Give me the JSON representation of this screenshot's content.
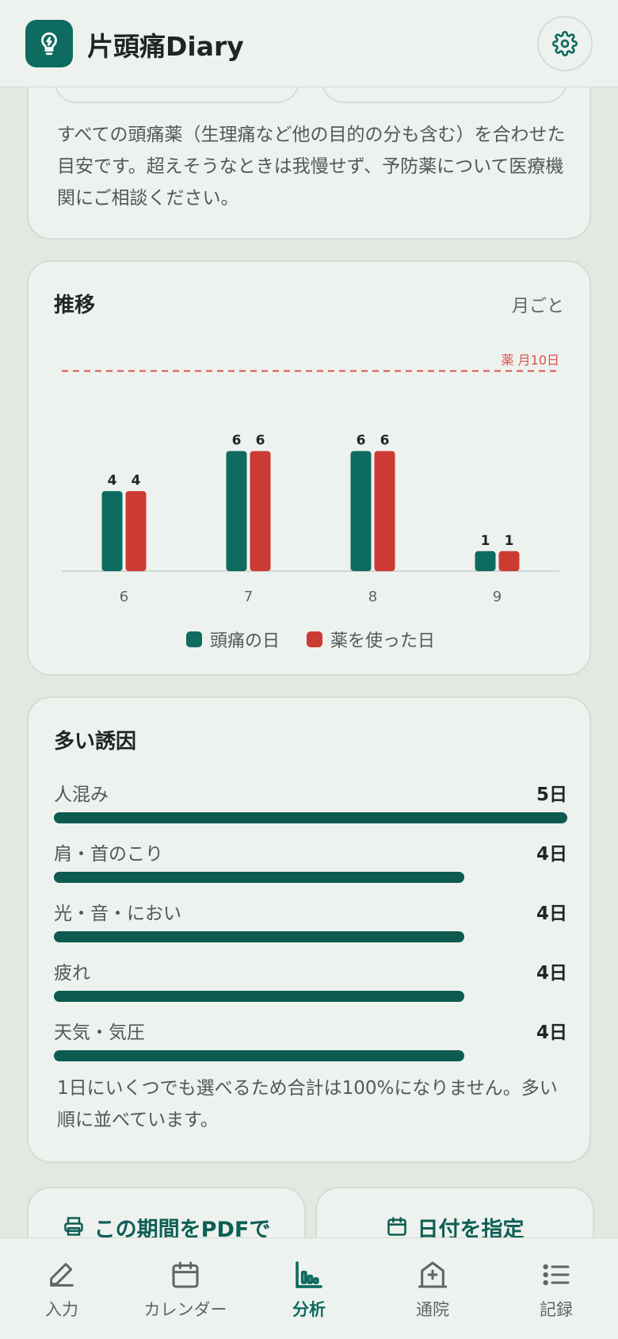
{
  "header": {
    "app_title": "片頭痛Diary",
    "logo_icon": "lightbulb-icon",
    "settings_icon": "gear-icon"
  },
  "medicine_card": {
    "note": "すべての頭痛薬（生理痛など他の目的の分も含む）を合わせた目安です。超えそうなときは我慢せず、予防薬について医療機関にご相談ください。"
  },
  "trend_card": {
    "title": "推移",
    "period": "月ごと"
  },
  "chart_data": {
    "type": "bar",
    "title": "推移",
    "categories": [
      "6",
      "7",
      "8",
      "9"
    ],
    "series": [
      {
        "name": "頭痛の日",
        "values": [
          4,
          6,
          6,
          1
        ],
        "color": "#0e6b60"
      },
      {
        "name": "薬を使った日",
        "values": [
          4,
          6,
          6,
          1
        ],
        "color": "#cc3b33"
      }
    ],
    "reference_line": {
      "value": 10,
      "label": "薬 月10日",
      "color": "#d9534f"
    },
    "ylim": [
      0,
      10.7
    ],
    "xlabel": "",
    "ylabel": "",
    "grid": false,
    "legend": "bottom"
  },
  "triggers_card": {
    "title": "多い誘因",
    "items": [
      {
        "name": "人混み",
        "count": "5日",
        "value": 5
      },
      {
        "name": "肩・首のこり",
        "count": "4日",
        "value": 4
      },
      {
        "name": "光・音・におい",
        "count": "4日",
        "value": 4
      },
      {
        "name": "疲れ",
        "count": "4日",
        "value": 4
      },
      {
        "name": "天気・気圧",
        "count": "4日",
        "value": 4
      }
    ],
    "max_value": 5,
    "note": "1日にいくつでも選べるため合計は100%になりません。多い順に並べています。"
  },
  "actions": {
    "pdf_label": "この期間をPDFで",
    "pdf_icon": "printer-icon",
    "date_label": "日付を指定",
    "date_icon": "calendar-icon"
  },
  "nav": {
    "items": [
      {
        "label": "入力",
        "icon": "pencil-icon"
      },
      {
        "label": "カレンダー",
        "icon": "calendar-icon"
      },
      {
        "label": "分析",
        "icon": "bar-chart-icon"
      },
      {
        "label": "通院",
        "icon": "hospital-icon"
      },
      {
        "label": "記録",
        "icon": "list-icon"
      }
    ],
    "active": "分析"
  },
  "colors": {
    "accent": "#0e6b60",
    "medicine": "#cc3b33",
    "background": "#e3e8e3",
    "card": "#eef2ee"
  }
}
